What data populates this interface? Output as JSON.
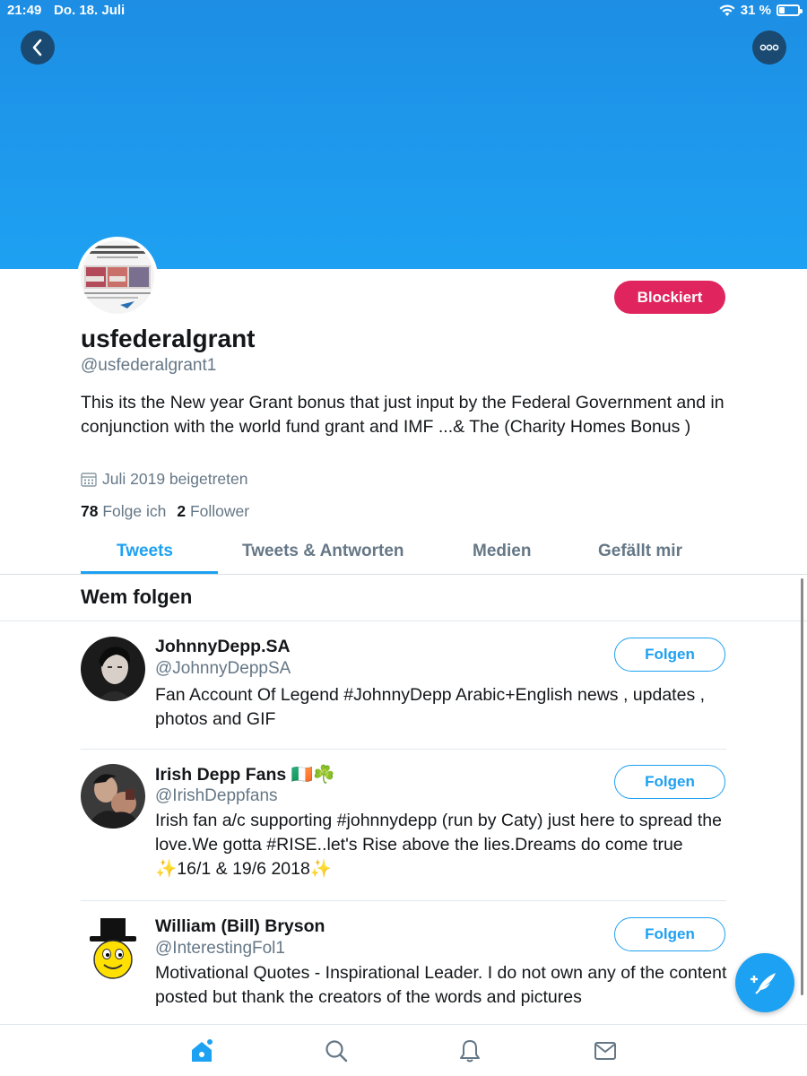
{
  "status_bar": {
    "time": "21:49",
    "date": "Do. 18. Juli",
    "battery": "31 %"
  },
  "profile": {
    "display_name": "usfederalgrant",
    "handle": "@usfederalgrant1",
    "bio": "This its the New year Grant bonus that just input by the Federal Government and in conjunction with the world fund grant and IMF ...& The (Charity Homes Bonus )",
    "joined": "Juli 2019 beigetreten",
    "following_count": "78",
    "following_label": "Folge ich",
    "followers_count": "2",
    "followers_label": "Follower",
    "blocked_label": "Blockiert"
  },
  "tabs": [
    "Tweets",
    "Tweets & Antworten",
    "Medien",
    "Gefällt mir"
  ],
  "section_title": "Wem folgen",
  "suggestions": [
    {
      "name": "JohnnyDepp.SA",
      "handle": "@JohnnyDeppSA",
      "bio": "Fan Account Of Legend #JohnnyDepp Arabic+English news , updates , photos and GIF",
      "button": "Folgen"
    },
    {
      "name": "Irish Depp Fans 🇮🇪☘️",
      "handle": "@IrishDeppfans",
      "bio": "Irish fan a/c supporting #johnnydepp (run by Caty) just here to spread the love.We gotta #RISE..let's Rise above the lies.Dreams do come true ✨16/1 & 19/6 2018✨",
      "button": "Folgen"
    },
    {
      "name": "William (Bill) Bryson",
      "handle": "@InterestingFol1",
      "bio": "Motivational Quotes - Inspirational Leader. I do not own any of the content posted but thank the creators of the words and pictures",
      "button": "Folgen"
    }
  ],
  "icons": {
    "back": "chevron-left-icon",
    "more": "more-dots-icon",
    "calendar": "calendar-icon",
    "compose": "compose-tweet-icon",
    "nav": [
      "home-icon",
      "search-icon",
      "notifications-icon",
      "messages-icon"
    ]
  },
  "colors": {
    "accent": "#1da1f2",
    "blocked": "#e0245e",
    "banner": "#1ea1f2",
    "secondary_text": "#657786"
  }
}
